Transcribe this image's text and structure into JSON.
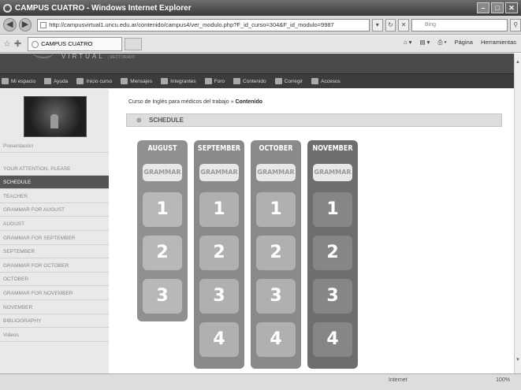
{
  "window": {
    "title": "CAMPUS CUATRO - Windows Internet Explorer"
  },
  "address": {
    "url": "http://campusvirtual1.uncu.edu.ar/contenido/campus4/ver_modulo.php?F_id_curso=304&F_id_modulo=9987",
    "search_placeholder": "Bing"
  },
  "tabs": {
    "active_tab": "CAMPUS CUATRO",
    "commands": [
      "Página",
      "Herramientas"
    ]
  },
  "banner": {
    "virtual": "VIRTUAL",
    "rectorado": "| RECTORADO"
  },
  "topnav": [
    "Mi espacio",
    "Ayuda",
    "Inicio curso",
    "Mensajes",
    "Integrantes",
    "Foro",
    "Contenido",
    "Corregir",
    "Accesos"
  ],
  "sidebar": {
    "items": [
      "Presentación",
      "YOUR ATTENTION, PLEASE",
      "SCHEDULE",
      "TEACHER",
      "GRAMMAR FOR AUGUST",
      "AUGUST",
      "GRAMMAR FOR SEPTEMBER",
      "SEPTEMBER",
      "GRAMMAR FOR OCTOBER",
      "OCTOBER",
      "GRAMMAR FOR NOVEMBER",
      "NOVEMBER",
      "BIBLIOGRAPHY",
      "Videos"
    ],
    "active": "SCHEDULE"
  },
  "main": {
    "breadcrumb_course": "Curso de Inglés para médicos del trabajo",
    "breadcrumb_sep": " » ",
    "breadcrumb_current": "Contenido",
    "section_title": "SCHEDULE",
    "months": [
      {
        "name": "AUGUST",
        "grammar": "GRAMMAR",
        "units": [
          "1",
          "2",
          "3"
        ],
        "color": "#909090",
        "tile": "#b8b8b8"
      },
      {
        "name": "SEPTEMBER",
        "grammar": "GRAMMAR",
        "units": [
          "1",
          "2",
          "3",
          "4"
        ],
        "color": "#8a8a8a",
        "tile": "#b0b0b0"
      },
      {
        "name": "OCTOBER",
        "grammar": "GRAMMAR",
        "units": [
          "1",
          "2",
          "3",
          "4"
        ],
        "color": "#8a8a8a",
        "tile": "#b0b0b0"
      },
      {
        "name": "NOVEMBER",
        "grammar": "GRAMMAR",
        "units": [
          "1",
          "2",
          "3",
          "4"
        ],
        "color": "#6e6e6e",
        "tile": "#868686"
      }
    ]
  },
  "status": {
    "zone": "Internet",
    "zoom": "100%"
  }
}
